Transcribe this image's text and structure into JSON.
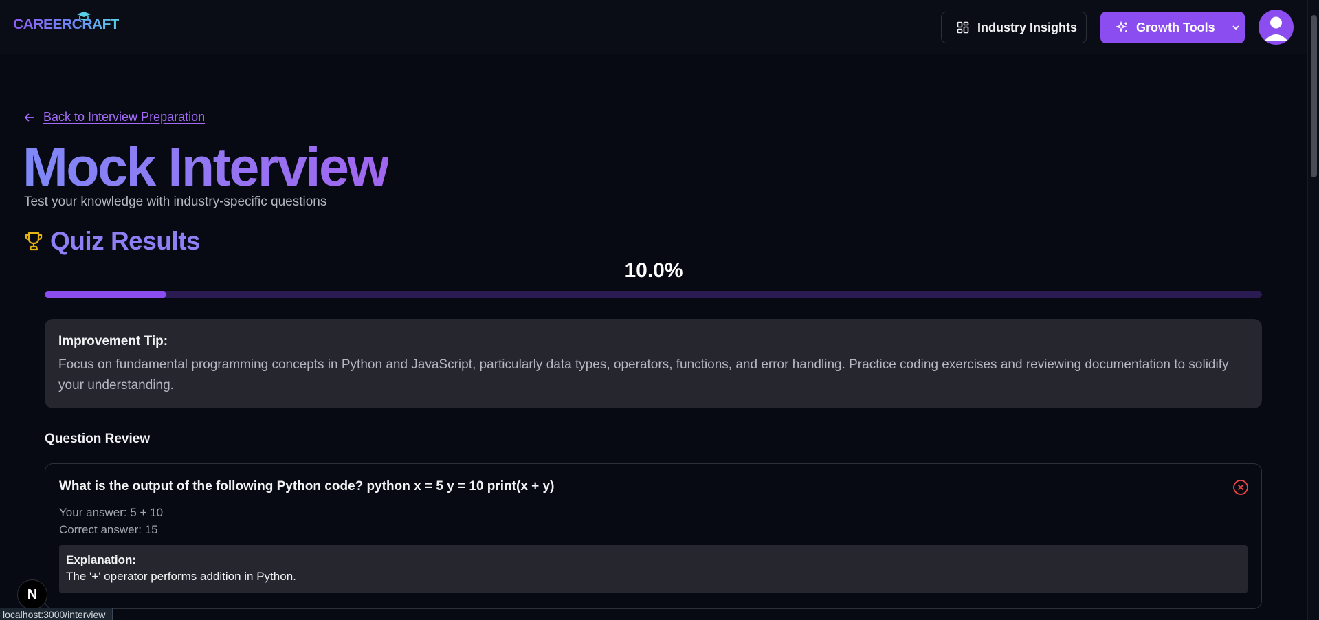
{
  "header": {
    "logo_text": "CAREERCRAFT",
    "industry_insights_label": "Industry Insights",
    "growth_tools_label": "Growth Tools",
    "accent_color": "#8b4cf0"
  },
  "back_link": {
    "label": "Back to Interview Preparation",
    "icon": "arrow-left-icon"
  },
  "page": {
    "title": "Mock Interview",
    "subtitle": "Test your knowledge with industry-specific questions"
  },
  "results": {
    "title": "Quiz Results",
    "icon": "trophy-icon",
    "score_text": "10.0%",
    "score_fraction": 0.1
  },
  "tip": {
    "label": "Improvement Tip:",
    "text": "Focus on fundamental programming concepts in Python and JavaScript, particularly data types, operators, functions, and error handling. Practice coding exercises and reviewing documentation to solidify your understanding."
  },
  "review": {
    "title": "Question Review",
    "questions": [
      {
        "question": "What is the output of the following Python code? python x = 5 y = 10 print(x + y)",
        "your_answer": "Your answer: 5 + 10",
        "correct_answer": "Correct answer: 15",
        "explanation_label": "Explanation:",
        "explanation": "The '+' operator performs addition in Python.",
        "status_icon": "x-circle-icon",
        "status_color": "#ef4444"
      }
    ]
  },
  "dev_badge": "N",
  "status_bar_url": "localhost:3000/interview"
}
